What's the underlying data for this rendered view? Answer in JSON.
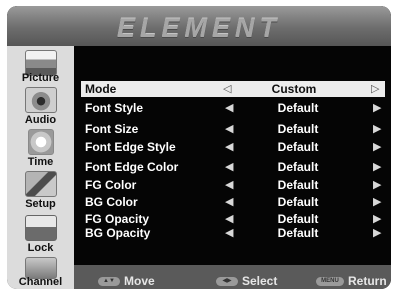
{
  "brand": "ELEMENT",
  "sidebar": {
    "items": [
      {
        "label": "Picture",
        "icon": "picture-icon"
      },
      {
        "label": "Audio",
        "icon": "audio-icon"
      },
      {
        "label": "Time",
        "icon": "time-icon"
      },
      {
        "label": "Setup",
        "icon": "setup-icon"
      },
      {
        "label": "Lock",
        "icon": "lock-icon"
      },
      {
        "label": "Channel",
        "icon": "channel-icon"
      }
    ]
  },
  "menu": {
    "rows": [
      {
        "name": "Mode",
        "value": "Custom",
        "selected": true
      },
      {
        "name": "Font Style",
        "value": "Default"
      },
      {
        "name": "Font Size",
        "value": "Default"
      },
      {
        "name": "Font Edge Style",
        "value": "Default"
      },
      {
        "name": "Font Edge Color",
        "value": "Default"
      },
      {
        "name": "FG Color",
        "value": "Default"
      },
      {
        "name": "BG Color",
        "value": "Default"
      },
      {
        "name": "FG Opacity",
        "value": "Default"
      },
      {
        "name": "BG Opacity",
        "value": "Default"
      }
    ]
  },
  "footer": {
    "move": "Move",
    "select": "Select",
    "menu_key": "MENU",
    "return": "Return"
  },
  "colors": {
    "menu_background": "#050505",
    "sidebar_background": "#dcdcdc",
    "selection_highlight": "#ececec",
    "footer_background": "#5a5a5a"
  }
}
